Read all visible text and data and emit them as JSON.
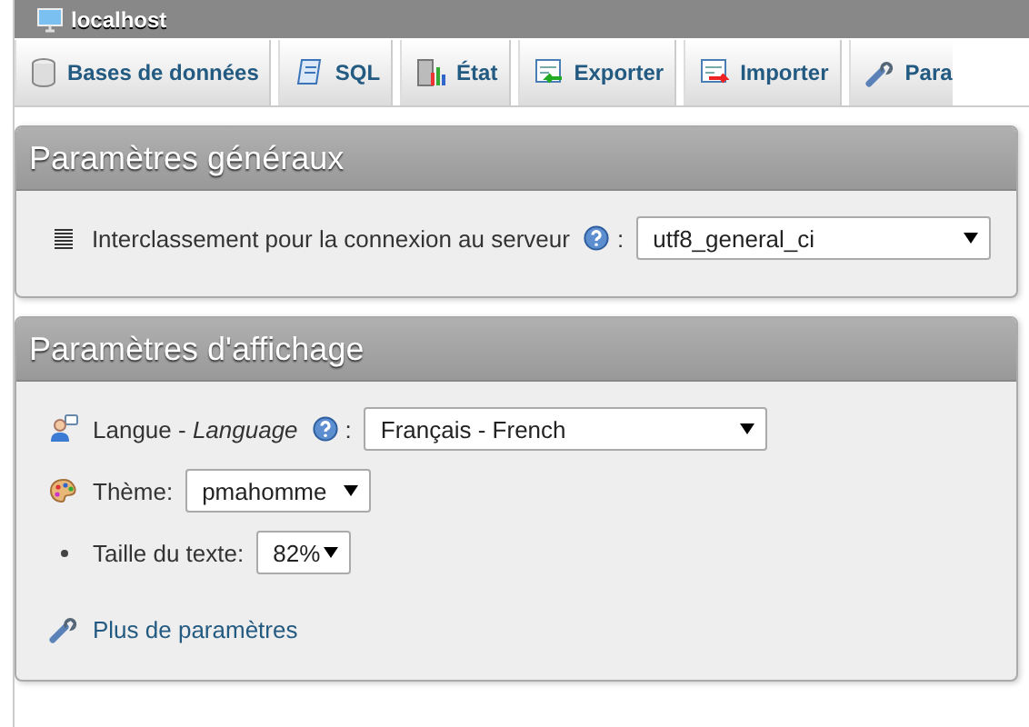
{
  "breadcrumb": {
    "server": "localhost"
  },
  "tabs": [
    {
      "label": "Bases de données"
    },
    {
      "label": "SQL"
    },
    {
      "label": "État"
    },
    {
      "label": "Exporter"
    },
    {
      "label": "Importer"
    },
    {
      "label": "Para"
    }
  ],
  "panels": [
    {
      "title": "Paramètres généraux",
      "rows": [
        {
          "kind": "select",
          "label": "Interclassement pour la connexion au serveur",
          "help": true,
          "colon": ":",
          "value": "utf8_general_ci"
        }
      ]
    },
    {
      "title": "Paramètres d'affichage",
      "rows": [
        {
          "kind": "select",
          "label": "Langue - *Language*",
          "help": true,
          "colon": ":",
          "value": "Français - French"
        },
        {
          "kind": "select",
          "label": "Thème:",
          "help": false,
          "value": "pmahomme"
        },
        {
          "kind": "select",
          "label": "Taille du texte:",
          "help": false,
          "value": "82%"
        },
        {
          "kind": "link",
          "label": "Plus de paramètres"
        }
      ]
    }
  ]
}
